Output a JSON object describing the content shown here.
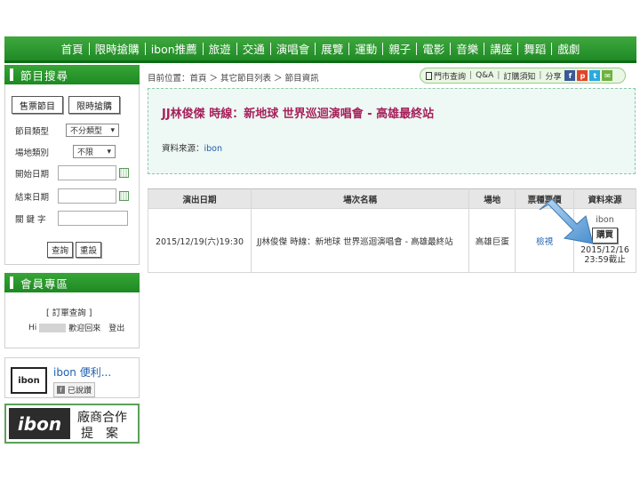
{
  "nav": {
    "items": [
      "首頁",
      "限時搶購",
      "ibon推薦",
      "旅遊",
      "交通",
      "演唱會",
      "展覽",
      "運動",
      "親子",
      "電影",
      "音樂",
      "講座",
      "舞蹈",
      "戲劇"
    ]
  },
  "sidebar": {
    "search_title": "節目搜尋",
    "tab_ticket": "售票節目",
    "tab_flash": "限時搶購",
    "type_label": "節目類型",
    "type_value": "不分類型",
    "venue_label": "場地類別",
    "venue_value": "不限",
    "start_label": "開始日期",
    "end_label": "結束日期",
    "keyword_label": "關 鍵 字",
    "query_button": "查詢",
    "reset_button": "重設",
    "member_title": "會員專區",
    "order_query": "[ 訂單查詢 ]",
    "hi": "Hi",
    "welcome": "歡迎回來",
    "logout": "登出"
  },
  "ads": {
    "fb_logo": "ibon",
    "fb_name": "ibon 便利...",
    "fb_like": "已說讚",
    "partner_logo": "ibon",
    "partner_line1": "廠商合作",
    "partner_line2": "提　案"
  },
  "breadcrumb": {
    "text": "目前位置：首頁 ＞ 其它節目列表 ＞ 節目資訊"
  },
  "toolbar": {
    "store_query": "門市查詢",
    "qa": "Q&A",
    "order_notice": "訂購須知",
    "share": "分享",
    "icons": [
      {
        "letter": "f",
        "color": "#3b5998"
      },
      {
        "letter": "p",
        "color": "#e0452b"
      },
      {
        "letter": "t",
        "color": "#2aa9e0"
      },
      {
        "letter": "✉",
        "color": "#6cb33f"
      }
    ]
  },
  "event": {
    "title": "JJ林俊傑 時線：新地球 世界巡迴演唱會 - 高雄最終站",
    "source_label": "資料來源：",
    "source_value": "ibon"
  },
  "table": {
    "headers": [
      "演出日期",
      "場次名稱",
      "場地",
      "票種票價",
      "資料來源"
    ],
    "row": {
      "date": "2015/12/19(六)19:30",
      "name": "JJ林俊傑 時線：新地球 世界巡迴演唱會 - 高雄最終站",
      "venue": "高雄巨蛋",
      "price_link": "檢視",
      "source": "ibon",
      "buy": "購買",
      "deadline_date": "2015/12/16",
      "deadline_time": "23:59截止"
    }
  }
}
